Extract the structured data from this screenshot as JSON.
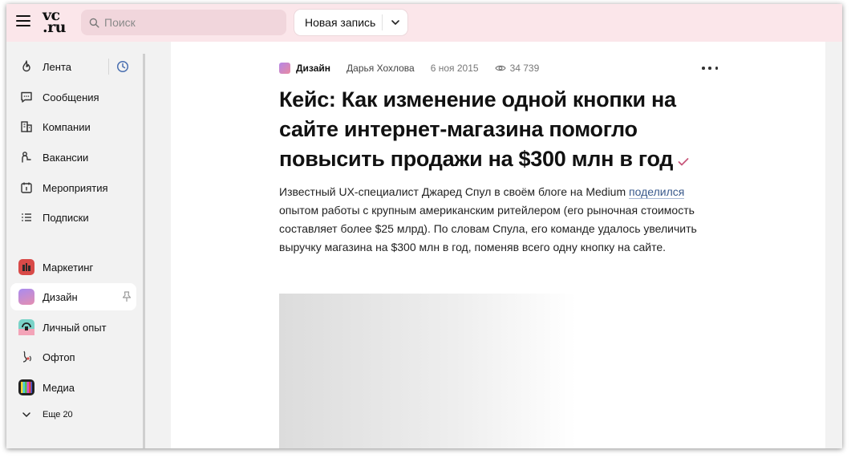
{
  "header": {
    "logo_line1": "vc",
    "logo_line2": ".ru",
    "search_placeholder": "Поиск",
    "new_post_label": "Новая запись",
    "colors": {
      "header_bg": "#fbe6ea",
      "search_bg": "#f1d6dc"
    }
  },
  "sidebar": {
    "nav": [
      {
        "label": "Лента",
        "icon": "flame-icon"
      },
      {
        "label": "Сообщения",
        "icon": "chat-icon"
      },
      {
        "label": "Компании",
        "icon": "building-icon"
      },
      {
        "label": "Вакансии",
        "icon": "job-icon"
      },
      {
        "label": "Мероприятия",
        "icon": "calendar-icon"
      },
      {
        "label": "Подписки",
        "icon": "list-icon"
      }
    ],
    "categories": [
      {
        "label": "Маркетинг",
        "icon": "marketing-icon"
      },
      {
        "label": "Дизайн",
        "icon": "design-icon",
        "active": true
      },
      {
        "label": "Личный опыт",
        "icon": "personal-experience-icon"
      },
      {
        "label": "Офтоп",
        "icon": "offtop-icon"
      },
      {
        "label": "Медиа",
        "icon": "media-icon"
      }
    ],
    "more_label": "Еще 20"
  },
  "article": {
    "category": "Дизайн",
    "author": "Дарья Хохлова",
    "date": "6 ноя 2015",
    "views": "34 739",
    "title": "Кейс: Как изменение одной кнопки на сайте интернет-магазина помогло повысить продажи на $300 млн в год",
    "lead_part1": "Известный UX-специалист Джаред Спул в своём блоге на Medium ",
    "lead_link": "поделился",
    "lead_part2": " опытом работы с крупным американским ритейлером (его рыночная стоимость составляет более $25 млрд). По словам Спула, его команде удалось увеличить выручку магазина на $300 млн в год, поменяв всего одну кнопку на сайте.",
    "colors": {
      "accent": "#c8577a",
      "link": "#3a5a8c"
    }
  }
}
